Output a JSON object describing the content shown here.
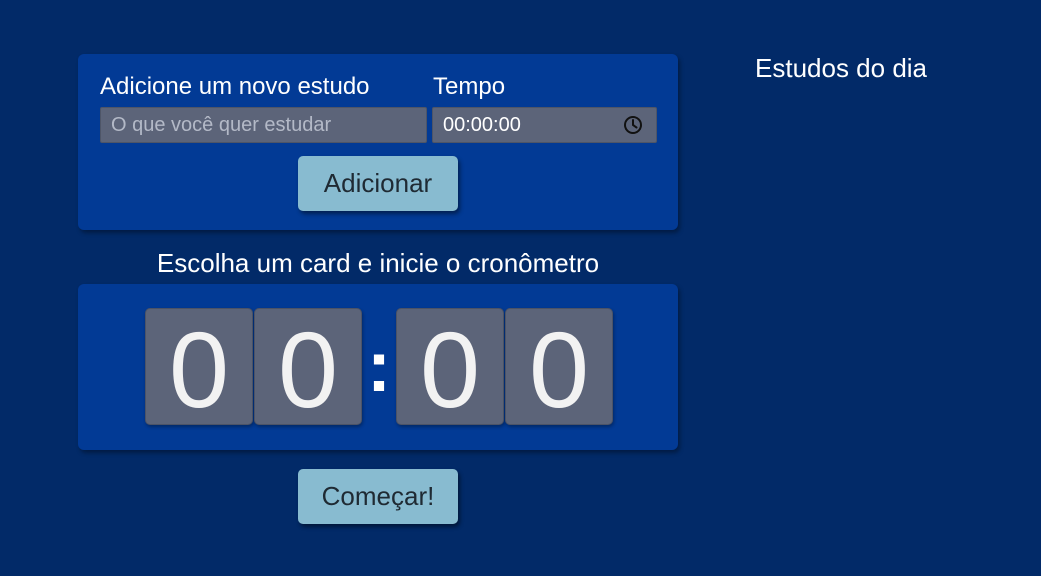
{
  "form": {
    "study_label": "Adicione um novo estudo",
    "study_placeholder": "O que você quer estudar",
    "time_label": "Tempo",
    "time_value": "00:00:00",
    "time_icon": "clock-icon",
    "add_button": "Adicionar"
  },
  "timer": {
    "instruction": "Escolha um card e inicie o cronômetro",
    "digits": [
      "0",
      "0",
      "0",
      "0"
    ],
    "separator": ":",
    "start_button": "Começar!"
  },
  "sidebar": {
    "title": "Estudos do dia"
  },
  "colors": {
    "background": "#022a68",
    "card": "#023a95",
    "field": "#5c6479",
    "button": "#88bbd0"
  }
}
